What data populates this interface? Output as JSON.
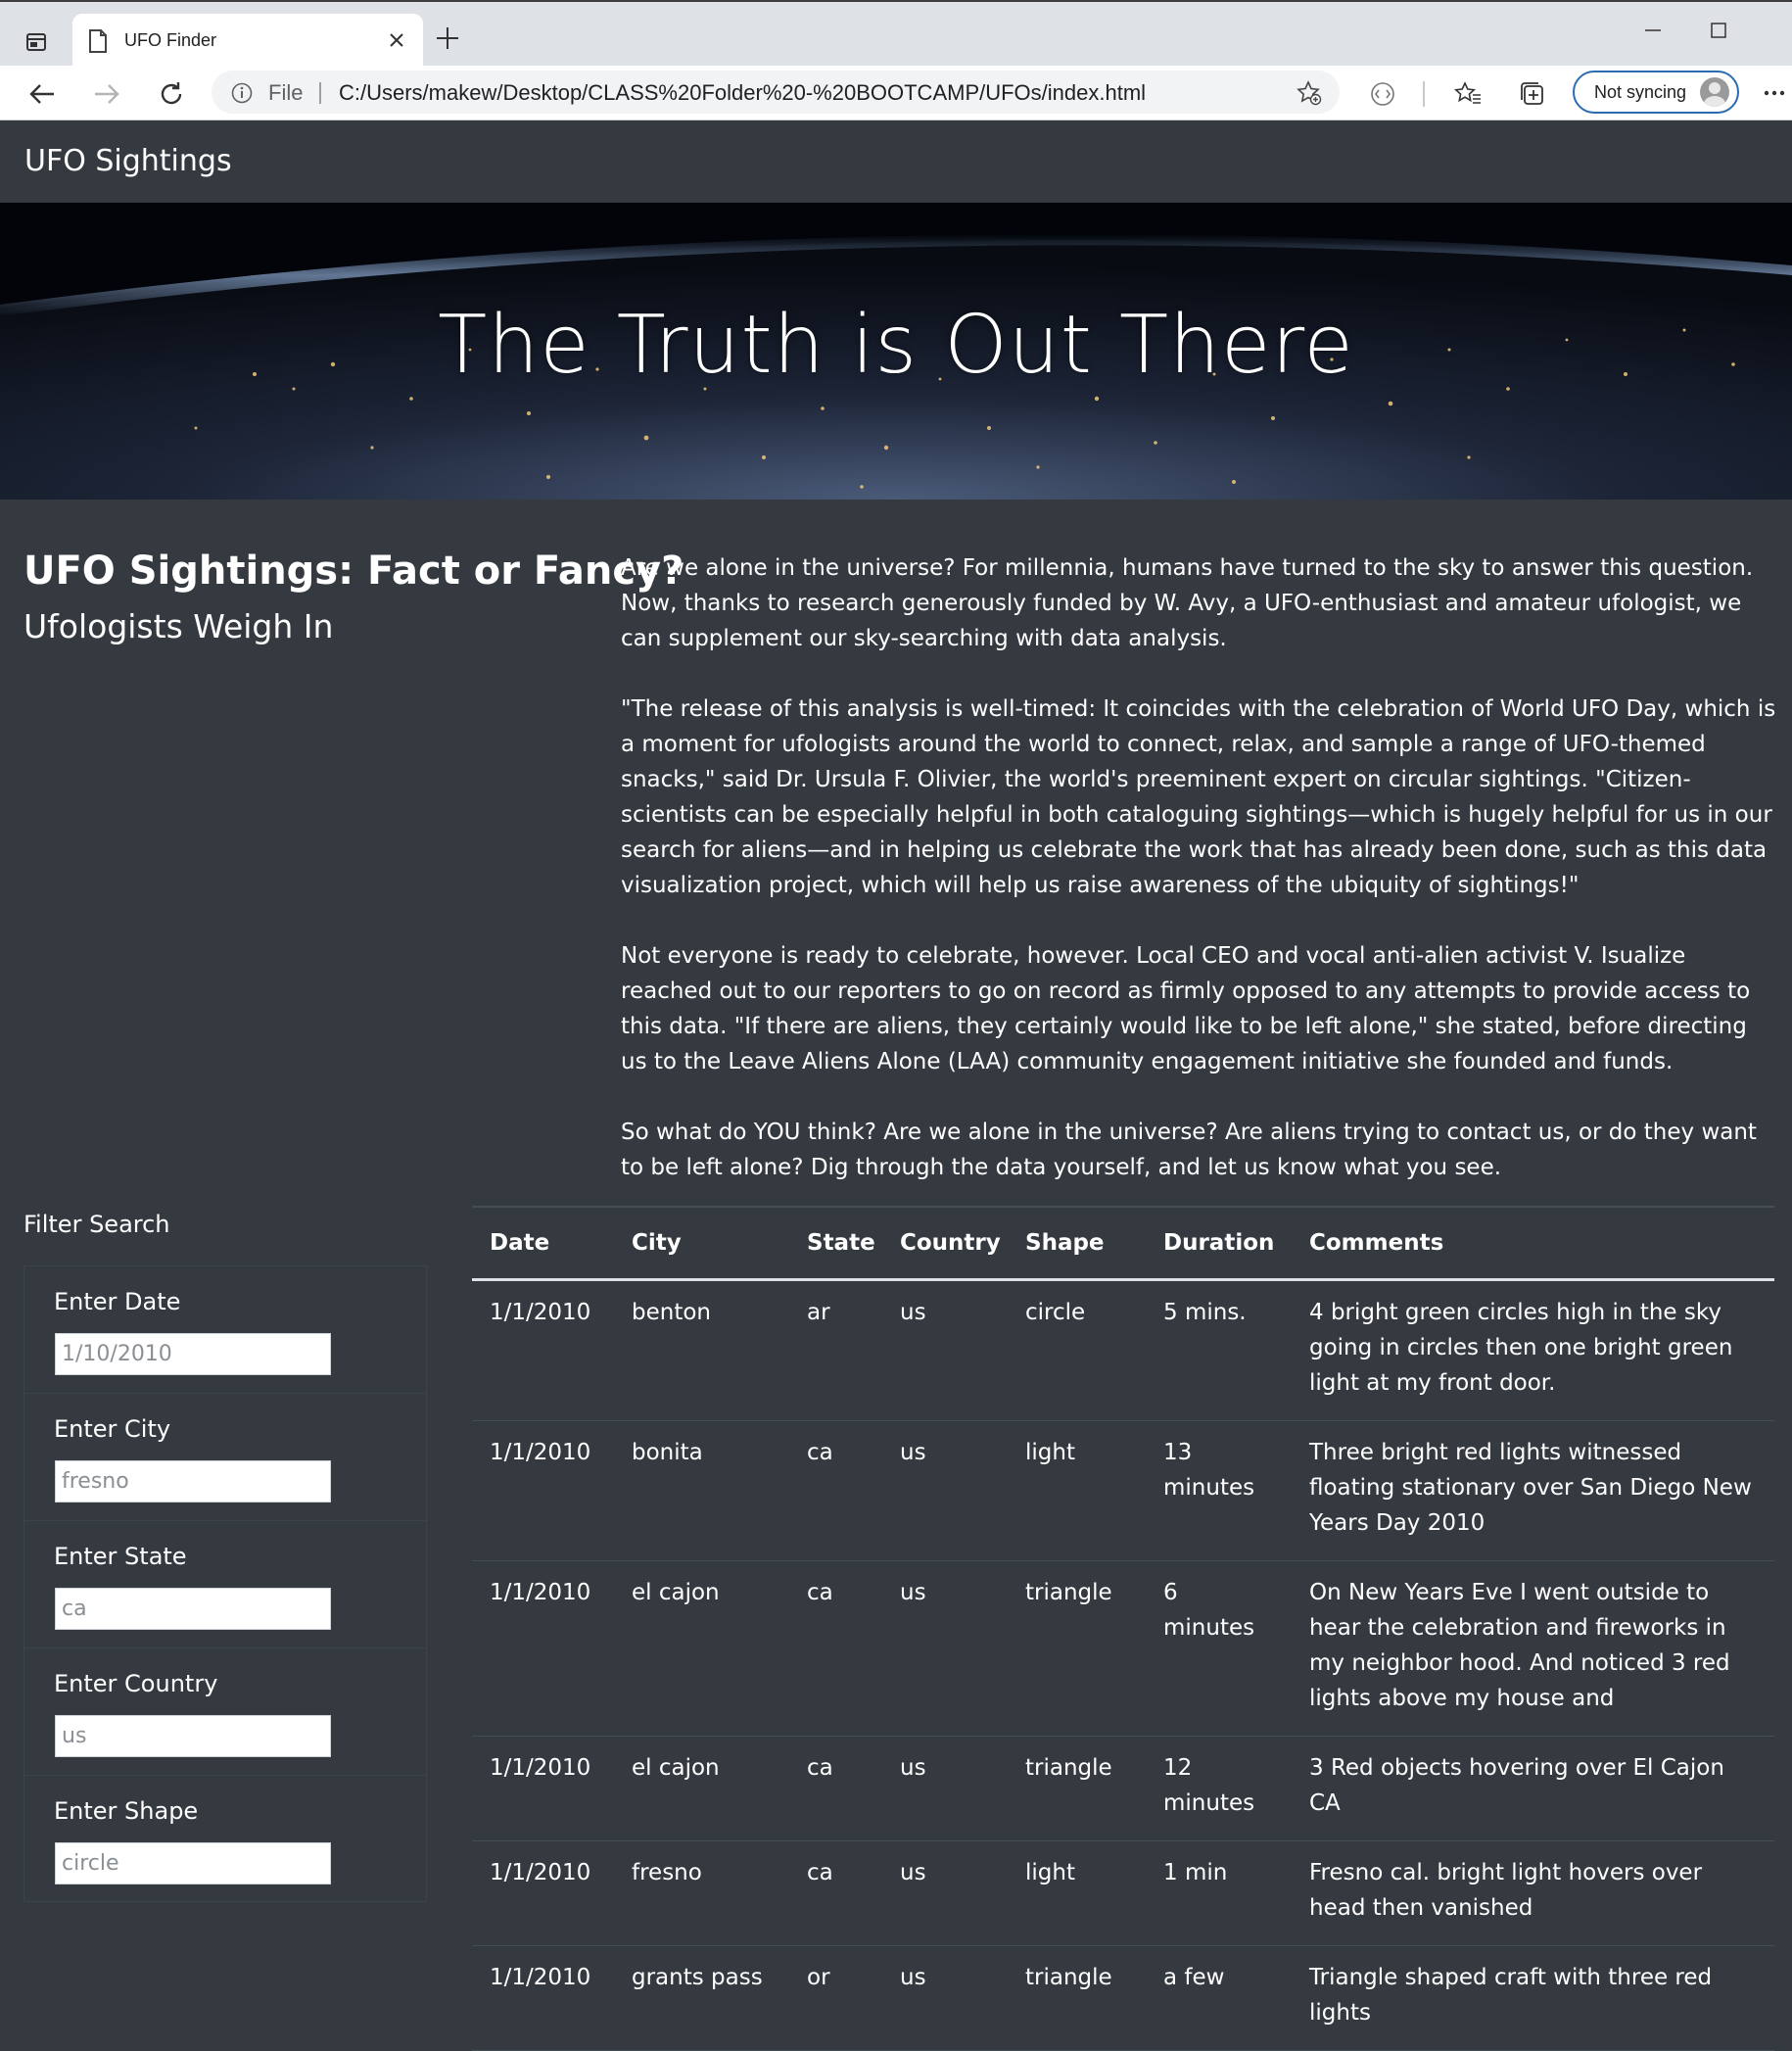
{
  "browser": {
    "tab_title": "UFO Finder",
    "address_prefix": "File",
    "url": "C:/Users/makew/Desktop/CLASS%20Folder%20-%20BOOTCAMP/UFOs/index.html",
    "sync_label": "Not syncing"
  },
  "navbar": {
    "brand": "UFO Sightings"
  },
  "hero": {
    "title": "The Truth is Out There"
  },
  "intro": {
    "heading": "UFO Sightings: Fact or Fancy?",
    "subheading": "Ufologists Weigh In",
    "paragraphs": [
      "Are we alone in the universe? For millennia, humans have turned to the sky to answer this question. Now, thanks to research generously funded by W. Avy, a UFO-enthusiast and amateur ufologist, we can supplement our sky-searching with data analysis.",
      "\"The release of this analysis is well-timed: It coincides with the celebration of World UFO Day, which is a moment for ufologists around the world to connect, relax, and sample a range of UFO-themed snacks,\" said Dr. Ursula F. Olivier, the world's preeminent expert on circular sightings. \"Citizen-scientists can be especially helpful in both cataloguing sightings—which is hugely helpful for us in our search for aliens—and in helping us celebrate the work that has already been done, such as this data visualization project, which will help us raise awareness of the ubiquity of sightings!\"",
      "Not everyone is ready to celebrate, however. Local CEO and vocal anti-alien activist V. Isualize reached out to our reporters to go on record as firmly opposed to any attempts to provide access to this data. \"If there are aliens, they certainly would like to be left alone,\" she stated, before directing us to the Leave Aliens Alone (LAA) community engagement initiative she founded and funds.",
      "So what do YOU think? Are we alone in the universe? Are aliens trying to contact us, or do they want to be left alone? Dig through the data yourself, and let us know what you see."
    ]
  },
  "filters": {
    "title": "Filter Search",
    "items": [
      {
        "label": "Enter Date",
        "placeholder": "1/10/2010"
      },
      {
        "label": "Enter City",
        "placeholder": "fresno"
      },
      {
        "label": "Enter State",
        "placeholder": "ca"
      },
      {
        "label": "Enter Country",
        "placeholder": "us"
      },
      {
        "label": "Enter Shape",
        "placeholder": "circle"
      }
    ]
  },
  "table": {
    "headers": [
      "Date",
      "City",
      "State",
      "Country",
      "Shape",
      "Duration",
      "Comments"
    ],
    "rows": [
      [
        "1/1/2010",
        "benton",
        "ar",
        "us",
        "circle",
        "5 mins.",
        "4 bright green circles high in the sky going in circles then one bright green light at my front door."
      ],
      [
        "1/1/2010",
        "bonita",
        "ca",
        "us",
        "light",
        "13 minutes",
        "Three bright red lights witnessed floating stationary over San Diego New Years Day 2010"
      ],
      [
        "1/1/2010",
        "el cajon",
        "ca",
        "us",
        "triangle",
        "6 minutes",
        "On New Years Eve I went outside to hear the celebration and fireworks in my neighbor hood. And noticed 3 red lights above my house and"
      ],
      [
        "1/1/2010",
        "el cajon",
        "ca",
        "us",
        "triangle",
        "12 minutes",
        "3 Red objects hovering over El Cajon CA"
      ],
      [
        "1/1/2010",
        "fresno",
        "ca",
        "us",
        "light",
        "1 min",
        "Fresno cal. bright light hovers over head then vanished"
      ],
      [
        "1/1/2010",
        "grants pass",
        "or",
        "us",
        "triangle",
        "a few",
        "Triangle shaped craft with three red lights"
      ]
    ]
  }
}
